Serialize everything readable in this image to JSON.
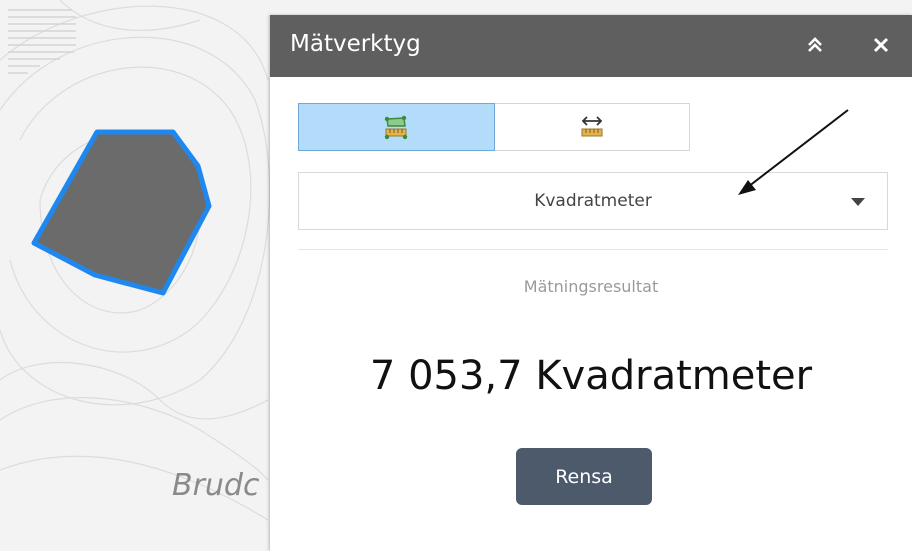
{
  "map": {
    "place_label": "Brudc",
    "polygon_fill": "#6b6b6b",
    "polygon_stroke": "#1e88f0"
  },
  "panel": {
    "title": "Mätverktyg",
    "collapse_icon": "double-chevron-up-icon",
    "close_icon": "close-icon"
  },
  "tools": {
    "area_icon": "area-measure-icon",
    "distance_icon": "distance-measure-icon",
    "active": "area"
  },
  "unit_select": {
    "selected": "Kvadratmeter"
  },
  "result": {
    "label": "Mätningsresultat",
    "value": "7 053,7 Kvadratmeter"
  },
  "clear_button": {
    "label": "Rensa"
  },
  "colors": {
    "header_bg": "#5f5f5f",
    "active_tool_bg": "#b3dcfb",
    "button_bg": "#4c5a6c"
  }
}
